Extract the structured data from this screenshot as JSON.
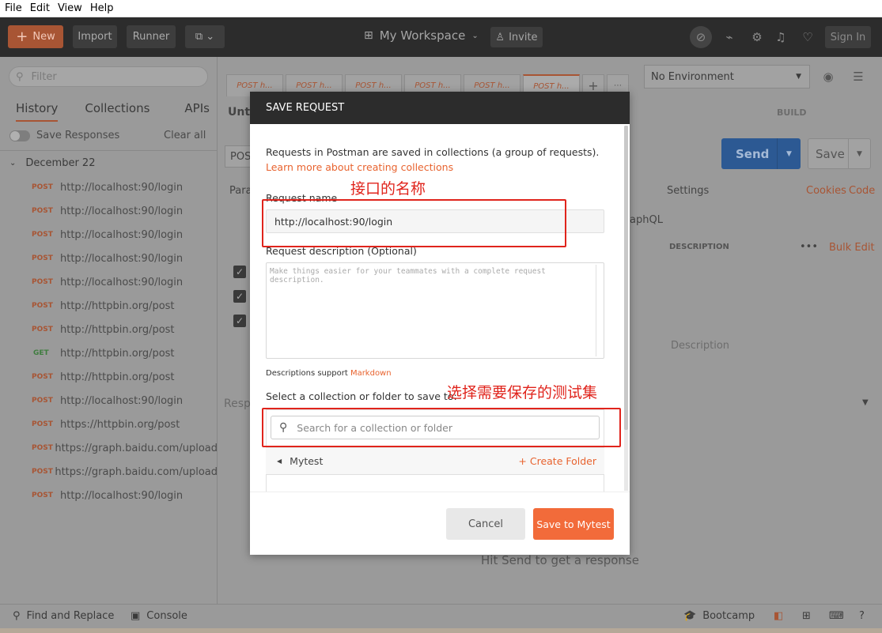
{
  "menu": [
    "File",
    "Edit",
    "View",
    "Help"
  ],
  "header": {
    "new_label": "New",
    "import_label": "Import",
    "runner_label": "Runner",
    "workspace_label": "My Workspace",
    "invite_label": "Invite",
    "signin_label": "Sign In"
  },
  "sidebar": {
    "filter_placeholder": "Filter",
    "tabs": [
      "History",
      "Collections",
      "APIs"
    ],
    "save_responses": "Save Responses",
    "clear_all": "Clear all",
    "group": "December 22",
    "items": [
      {
        "method": "POST",
        "url": "http://localhost:90/login"
      },
      {
        "method": "POST",
        "url": "http://localhost:90/login"
      },
      {
        "method": "POST",
        "url": "http://localhost:90/login"
      },
      {
        "method": "POST",
        "url": "http://localhost:90/login"
      },
      {
        "method": "POST",
        "url": "http://localhost:90/login"
      },
      {
        "method": "POST",
        "url": "http://httpbin.org/post"
      },
      {
        "method": "POST",
        "url": "http://httpbin.org/post"
      },
      {
        "method": "GET",
        "url": "http://httpbin.org/post"
      },
      {
        "method": "POST",
        "url": "http://httpbin.org/post"
      },
      {
        "method": "POST",
        "url": "http://localhost:90/login"
      },
      {
        "method": "POST",
        "url": "https://httpbin.org/post"
      },
      {
        "method": "POST",
        "url": "https://graph.baidu.com/upload"
      },
      {
        "method": "POST",
        "url": "https://graph.baidu.com/upload"
      },
      {
        "method": "POST",
        "url": "http://localhost:90/login"
      }
    ]
  },
  "main": {
    "tabs": [
      "POST h...",
      "POST h...",
      "POST h...",
      "POST h...",
      "POST h...",
      "POST h..."
    ],
    "environment": "No Environment",
    "title": "Unti",
    "build": "BUILD",
    "method_prefix": "POS",
    "send_label": "Send",
    "save_label": "Save",
    "params_label": "Para",
    "settings_label": "Settings",
    "cookies_label": "Cookies",
    "code_label": "Code",
    "graphql_label": "aphQL",
    "description_header": "DESCRIPTION",
    "bulk_edit": "Bulk Edit",
    "description_placeholder": "Description",
    "response_label": "Resp",
    "hit_send": "Hit Send to get a response"
  },
  "status": {
    "find_replace": "Find and Replace",
    "console": "Console",
    "bootcamp": "Bootcamp"
  },
  "modal": {
    "title": "SAVE REQUEST",
    "intro": "Requests in Postman are saved in collections (a group of requests).",
    "learn_more": "Learn more about creating collections",
    "name_label": "Request name",
    "name_value": "http://localhost:90/login",
    "desc_label": "Request description (Optional)",
    "desc_placeholder": "Make things easier for your teammates with a complete request description.",
    "desc_support": "Descriptions support",
    "markdown": "Markdown",
    "select_label": "Select a collection or folder to save to:",
    "search_placeholder": "Search for a collection or folder",
    "collection": "Mytest",
    "create_folder": "+ Create Folder",
    "cancel_label": "Cancel",
    "save_label": "Save to Mytest"
  },
  "annotations": {
    "name_note": "接口的名称",
    "collection_note": "选择需要保存的测试集",
    "color": "#e0241c"
  },
  "colors": {
    "accent": "#f26b3a",
    "send_blue": "#2c5993",
    "header_dark": "#2c2c2c"
  }
}
